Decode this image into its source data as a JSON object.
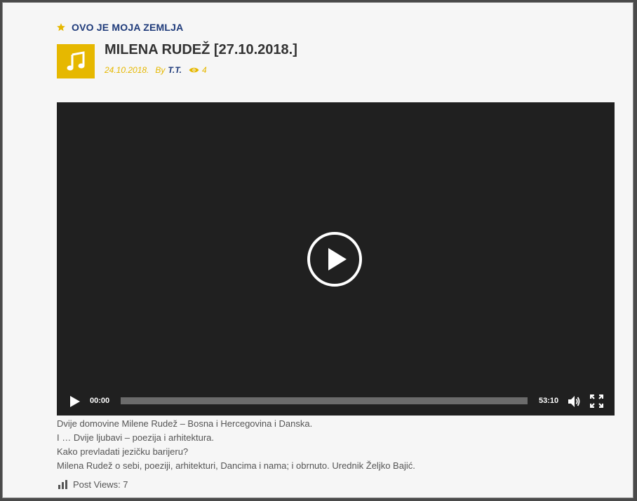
{
  "category": {
    "label": "OVO JE MOJA ZEMLJA",
    "icon": "star-icon"
  },
  "post": {
    "thumb_icon": "music-note-icon",
    "title": "MILENA RUDEŽ [27.10.2018.]",
    "date": "24.10.2018.",
    "by_label": "By",
    "author": "T.T.",
    "view_count": "4"
  },
  "player": {
    "current_time": "00:00",
    "duration": "53:10",
    "progress": 0
  },
  "description": [
    "Dvije domovine Milene Rudež – Bosna i Hercegovina i Danska.",
    "I … Dvije ljubavi – poezija i arhitektura.",
    "Kako prevladati jezičku barijeru?",
    "Milena Rudež o sebi, poeziji, arhitekturi, Dancima i nama; i obrnuto. Urednik Željko Bajić."
  ],
  "post_views": {
    "label": "Post Views: 7"
  },
  "colors": {
    "accent_yellow": "#e6b800",
    "link_blue": "#1e3a7a",
    "player_bg": "#202020"
  }
}
